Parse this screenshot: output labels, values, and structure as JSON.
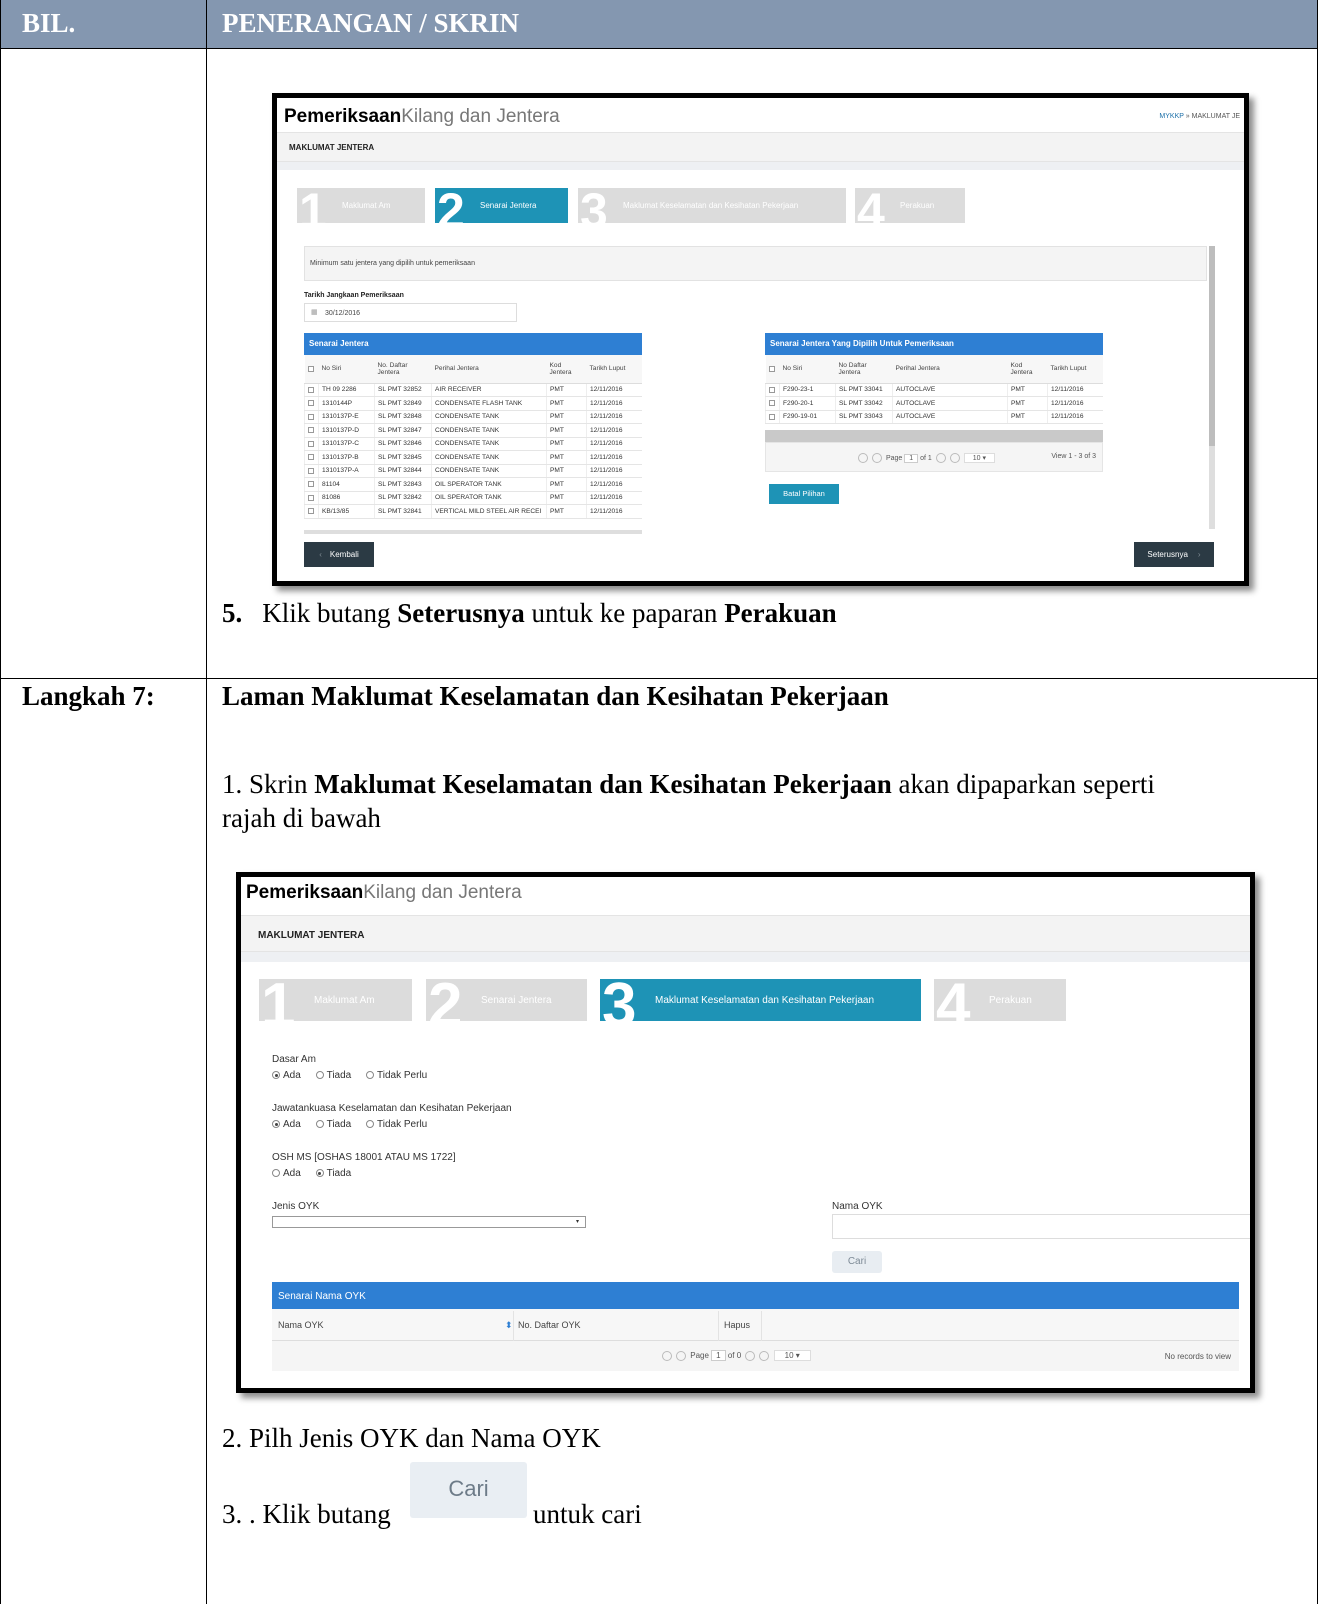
{
  "header": {
    "col1": "BIL.",
    "col2": "PENERANGAN / SKRIN"
  },
  "step5": {
    "num": "5.",
    "pre": "Klik butang",
    "btn": "Seterusnya",
    "mid": "untuk ke paparan",
    "target": "Perakuan"
  },
  "step7": {
    "label": "Langkah 7:",
    "title": "Laman Maklumat Keselamatan dan Kesihatan Pekerjaan",
    "i1_pre": "1. Skrin",
    "i1_bold": "Maklumat Keselamatan dan Kesihatan Pekerjaan",
    "i1_post": "akan dipaparkan seperti",
    "i1_post2": "rajah  di bawah",
    "i2": "2. Pilh Jenis OYK dan Nama OYK",
    "i3_pre": "3. . Klik butang",
    "i3_btn": "Cari",
    "i3_post": "untuk cari"
  },
  "app": {
    "brand_bold": "Pemeriksaan",
    "brand_light": "Kilang dan Jentera",
    "breadcrumb_home": "MYKKP",
    "breadcrumb_sep": "»",
    "breadcrumb_current": "MAKLUMAT JE",
    "subtitle": "MAKLUMAT JENTERA",
    "steps": [
      {
        "num": "1",
        "label": "Maklumat Am"
      },
      {
        "num": "2",
        "label": "Senarai Jentera"
      },
      {
        "num": "3",
        "label": "Maklumat Keselamatan dan Kesihatan Pekerjaan"
      },
      {
        "num": "4",
        "label": "Perakuan"
      }
    ]
  },
  "screen1": {
    "notice": "Minimum satu jentera yang dipilih untuk pemeriksaan",
    "date_label": "Tarikh Jangkaan Pemeriksaan",
    "date_value": "30/12/2016",
    "left_title": "Senarai Jentera",
    "right_title": "Senarai Jentera Yang Dipilih Untuk Pemeriksaan",
    "cols": [
      "No Siri",
      "No. Daftar Jentera",
      "Perihal Jentera",
      "Kod Jentera",
      "Tarikh Luput"
    ],
    "right_cols": [
      "No Siri",
      "No Daftar Jentera",
      "Perihal Jentera",
      "Kod Jentera",
      "Tarikh Luput"
    ],
    "left_rows": [
      [
        "TH 09 2286",
        "SL PMT 32852",
        "AIR RECEIVER",
        "PMT",
        "12/11/2016"
      ],
      [
        "1310144P",
        "SL PMT 32849",
        "CONDENSATE FLASH TANK",
        "PMT",
        "12/11/2016"
      ],
      [
        "1310137P-E",
        "SL PMT 32848",
        "CONDENSATE TANK",
        "PMT",
        "12/11/2016"
      ],
      [
        "1310137P-D",
        "SL PMT 32847",
        "CONDENSATE TANK",
        "PMT",
        "12/11/2016"
      ],
      [
        "1310137P-C",
        "SL PMT 32846",
        "CONDENSATE TANK",
        "PMT",
        "12/11/2016"
      ],
      [
        "1310137P-B",
        "SL PMT 32845",
        "CONDENSATE TANK",
        "PMT",
        "12/11/2016"
      ],
      [
        "1310137P-A",
        "SL PMT 32844",
        "CONDENSATE TANK",
        "PMT",
        "12/11/2016"
      ],
      [
        "81104",
        "SL PMT 32843",
        "OIL SPERATOR TANK",
        "PMT",
        "12/11/2016"
      ],
      [
        "81086",
        "SL PMT 32842",
        "OIL SPERATOR TANK",
        "PMT",
        "12/11/2016"
      ],
      [
        "KB/13/85",
        "SL PMT 32841",
        "VERTICAL MILD STEEL AIR RECEI",
        "PMT",
        "12/11/2016"
      ]
    ],
    "right_rows": [
      [
        "F290-23-1",
        "SL PMT 33041",
        "AUTOCLAVE",
        "PMT",
        "12/11/2016"
      ],
      [
        "F290-20-1",
        "SL PMT 33042",
        "AUTOCLAVE",
        "PMT",
        "12/11/2016"
      ],
      [
        "F290-19-01",
        "SL PMT 33043",
        "AUTOCLAVE",
        "PMT",
        "12/11/2016"
      ]
    ],
    "pager_page": "Page",
    "pager_num": "1",
    "pager_of": "of 1",
    "pager_size": "10",
    "pager_view": "View 1 - 3 of 3",
    "batal": "Batal Pilihan",
    "kembali": "Kembali",
    "seterusnya": "Seterusnya"
  },
  "screen2": {
    "q1": "Dasar Am",
    "q1_opts": [
      "Ada",
      "Tiada",
      "Tidak Perlu"
    ],
    "q2": "Jawatankuasa Keselamatan dan Kesihatan Pekerjaan",
    "q2_opts": [
      "Ada",
      "Tiada",
      "Tidak Perlu"
    ],
    "q3": "OSH MS [OSHAS 18001 ATAU MS 1722]",
    "q3_opts": [
      "Ada",
      "Tiada"
    ],
    "jenis_label": "Jenis OYK",
    "nama_label": "Nama OYK",
    "cari": "Cari",
    "list_title": "Senarai Nama OYK",
    "list_cols": [
      "Nama OYK",
      "No. Daftar OYK",
      "Hapus"
    ],
    "sort_icon": "⬍",
    "pager_page": "Page",
    "pager_num": "1",
    "pager_of": "of 0",
    "pager_size": "10",
    "no_records": "No records to view"
  }
}
